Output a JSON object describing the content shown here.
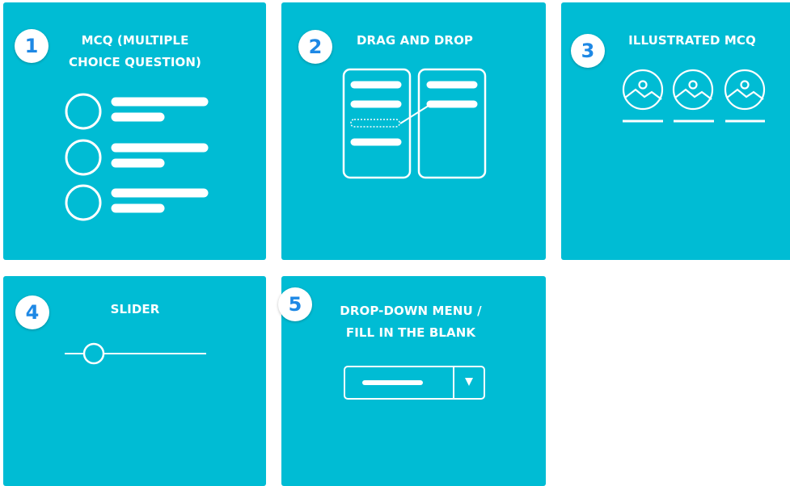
{
  "tiles": [
    {
      "number": "1",
      "title_lines": [
        "MCQ (MULTIPLE",
        "CHOICE QUESTION)"
      ],
      "icon": "mcq-illustration-icon"
    },
    {
      "number": "2",
      "title_lines": [
        "DRAG AND DROP"
      ],
      "icon": "drag-and-drop-illustration-icon"
    },
    {
      "number": "3",
      "title_lines": [
        "ILLUSTRATED MCQ"
      ],
      "icon": "illustrated-mcq-illustration-icon"
    },
    {
      "number": "4",
      "title_lines": [
        "SLIDER"
      ],
      "icon": "slider-illustration-icon"
    },
    {
      "number": "5",
      "title_lines": [
        "DROP-DOWN MENU /",
        "FILL IN THE BLANK"
      ],
      "icon": "dropdown-illustration-icon"
    }
  ],
  "colors": {
    "tile_background": "#00bcd4",
    "badge_background": "#ffffff",
    "badge_text": "#1e88e5",
    "line_art": "#ffffff"
  }
}
